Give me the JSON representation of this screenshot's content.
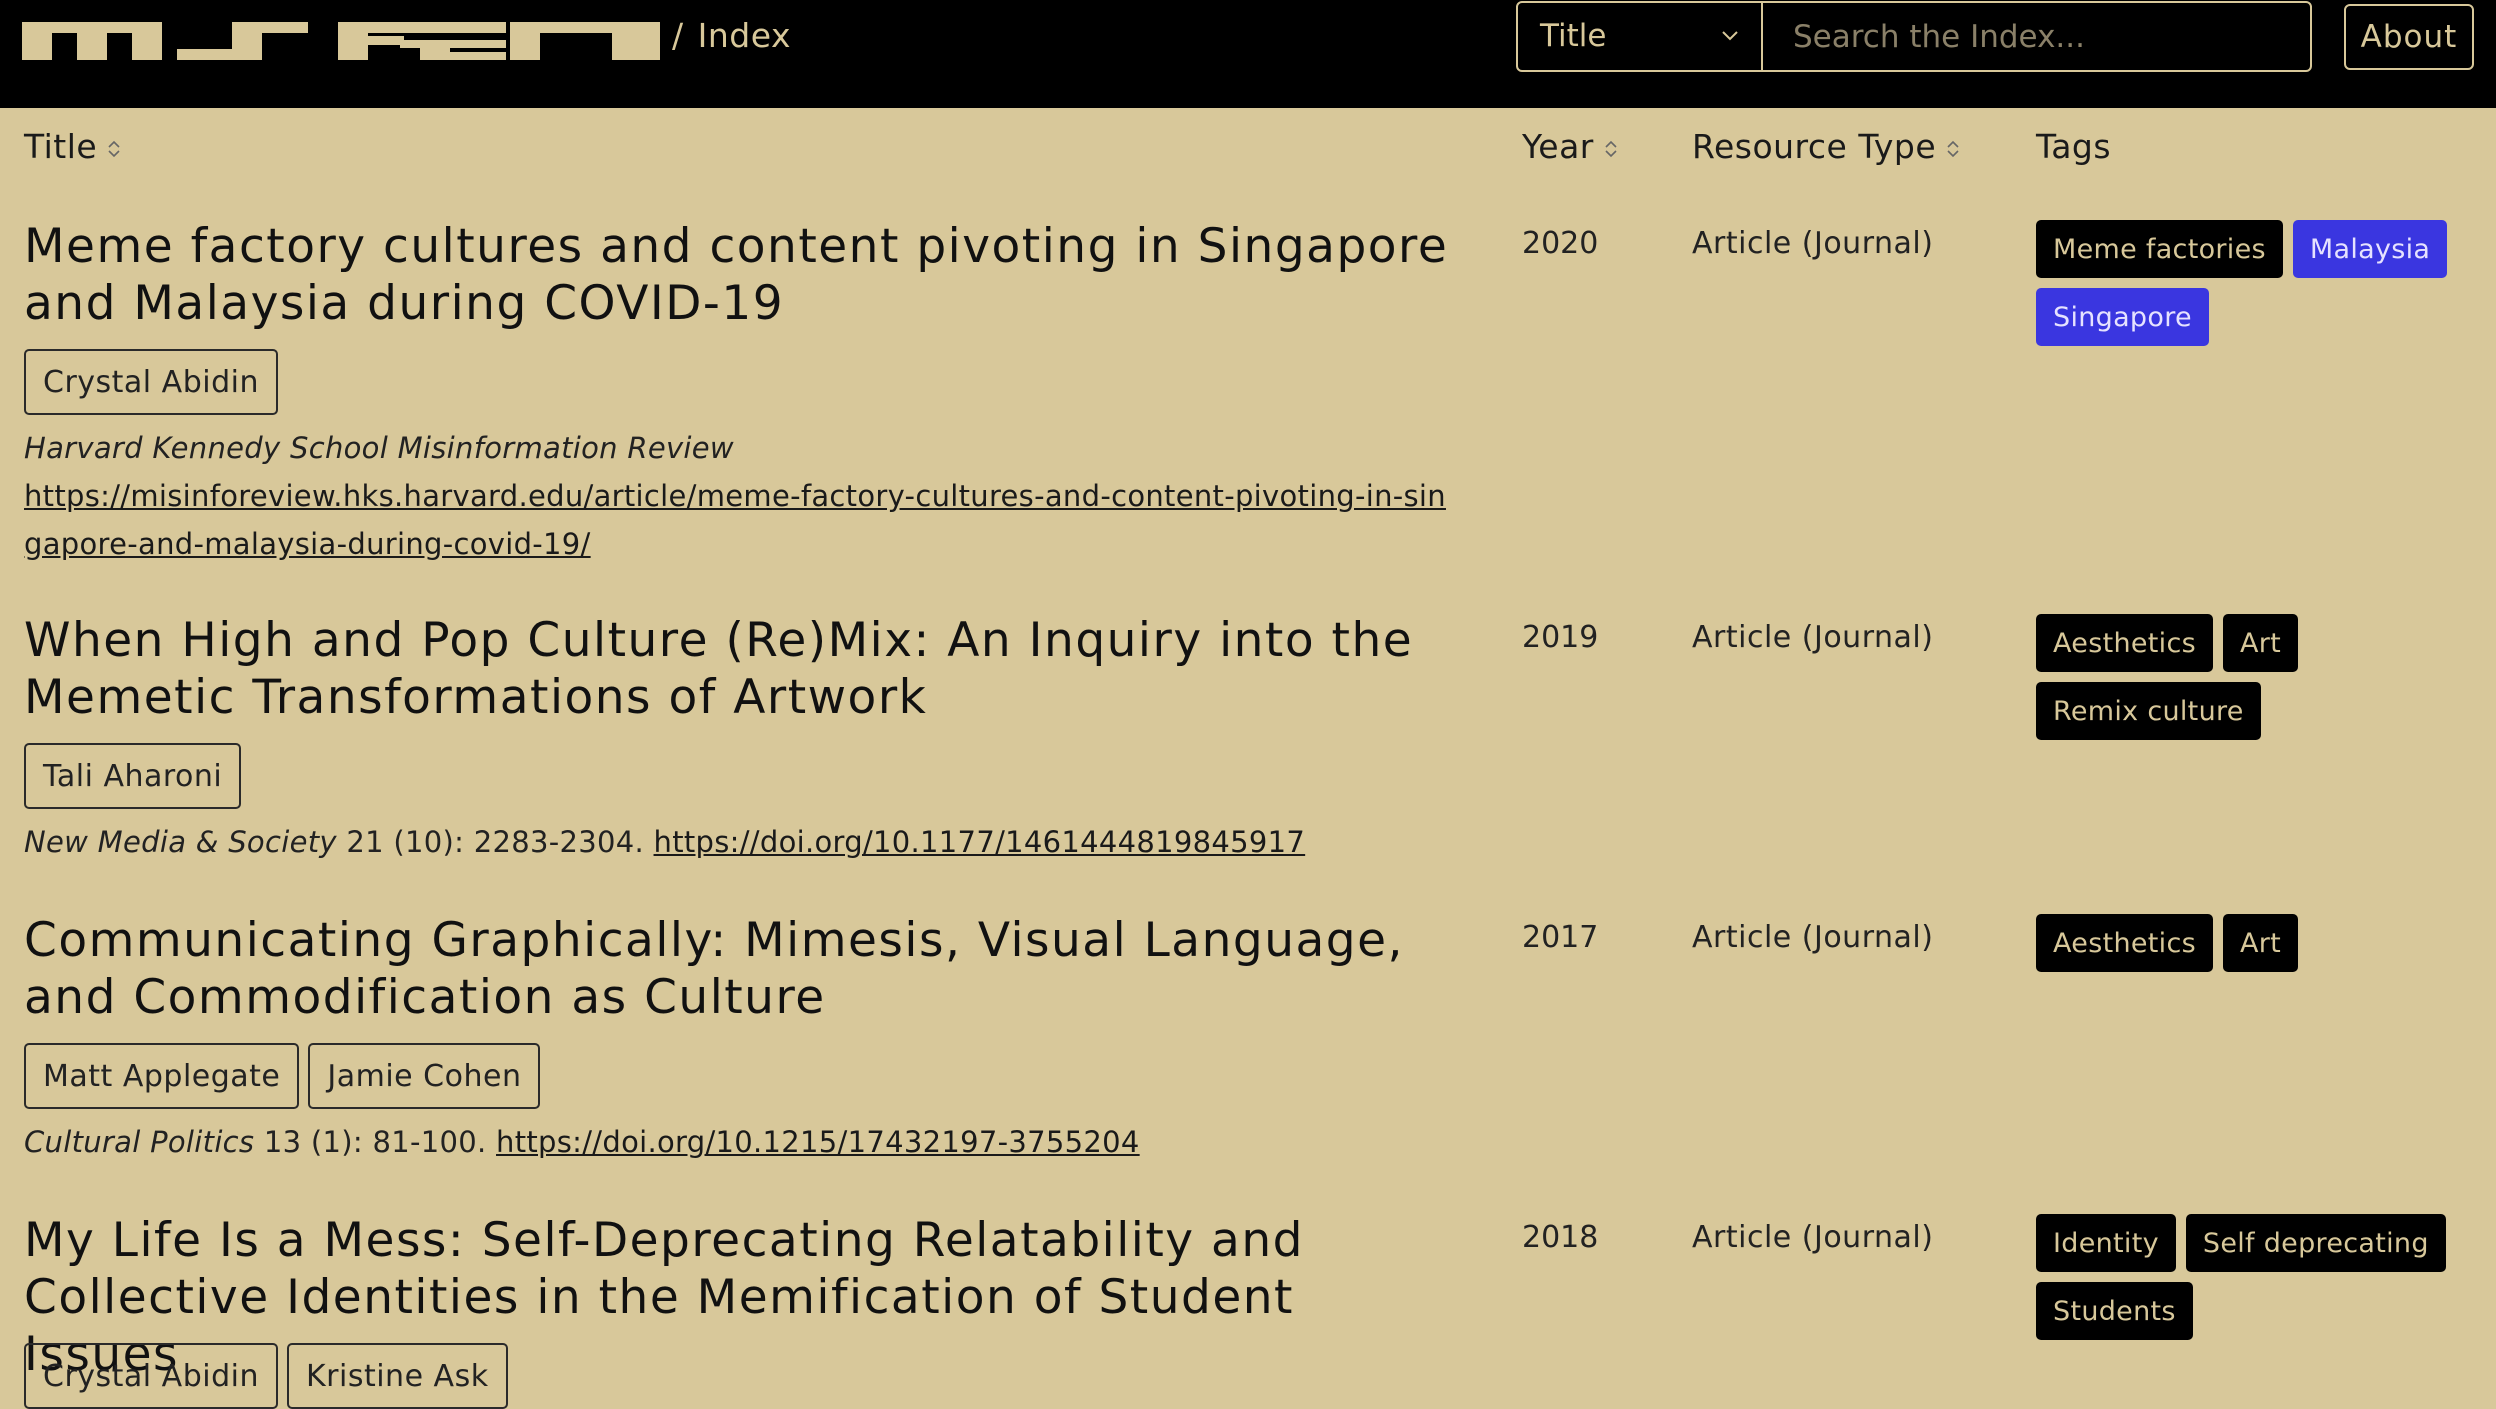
{
  "header": {
    "breadcrumb_sep": "/",
    "breadcrumb_current": "Index",
    "field_select_value": "Title",
    "search_placeholder": "Search the Index...",
    "about_label": "About"
  },
  "columns": {
    "title": "Title",
    "year": "Year",
    "resource_type": "Resource Type",
    "tags": "Tags"
  },
  "rows": [
    {
      "title": "Meme factory cultures and content pivoting in Singapore and Malaysia during COVID-19",
      "authors": [
        "Crystal Abidin"
      ],
      "venue": "Harvard Kennedy School Misinformation Review",
      "citation": "",
      "url": "https://misinforeview.hks.harvard.edu/article/meme-factory-cultures-and-content-pivoting-in-singapore-and-malaysia-during-covid-19/",
      "year": "2020",
      "resource_type": "Article (Journal)",
      "tags": [
        "Meme factories",
        "Malaysia",
        "Singapore"
      ]
    },
    {
      "title": "When High and Pop Culture (Re)Mix: An Inquiry into the Memetic Transformations of Artwork",
      "authors": [
        "Tali Aharoni"
      ],
      "venue": "New Media & Society",
      "citation": " 21 (10): 2283-2304. ",
      "url": "https://doi.org/10.1177/1461444819845917",
      "year": "2019",
      "resource_type": "Article (Journal)",
      "tags": [
        "Aesthetics",
        "Art",
        "Remix culture"
      ]
    },
    {
      "title": "Communicating Graphically: Mimesis, Visual Language, and Commodification as Culture",
      "authors": [
        "Matt Applegate",
        "Jamie Cohen"
      ],
      "venue": "Cultural Politics",
      "citation": " 13 (1): 81-100. ",
      "url": "https://doi.org/10.1215/17432197-3755204",
      "year": "2017",
      "resource_type": "Article (Journal)",
      "tags": [
        "Aesthetics",
        "Art"
      ]
    },
    {
      "title": "My Life Is a Mess: Self-Deprecating Relatability and Collective Identities in the Memification of Student Issues",
      "authors": [
        "Crystal Abidin",
        "Kristine Ask"
      ],
      "year": "2018",
      "resource_type": "Article (Journal)",
      "tags": [
        "Identity",
        "Self deprecating",
        "Students"
      ]
    }
  ],
  "colors": {
    "background": "#d8c89a",
    "header": "#000000",
    "tag": "#000000",
    "place_tag": "#3a36e0"
  }
}
